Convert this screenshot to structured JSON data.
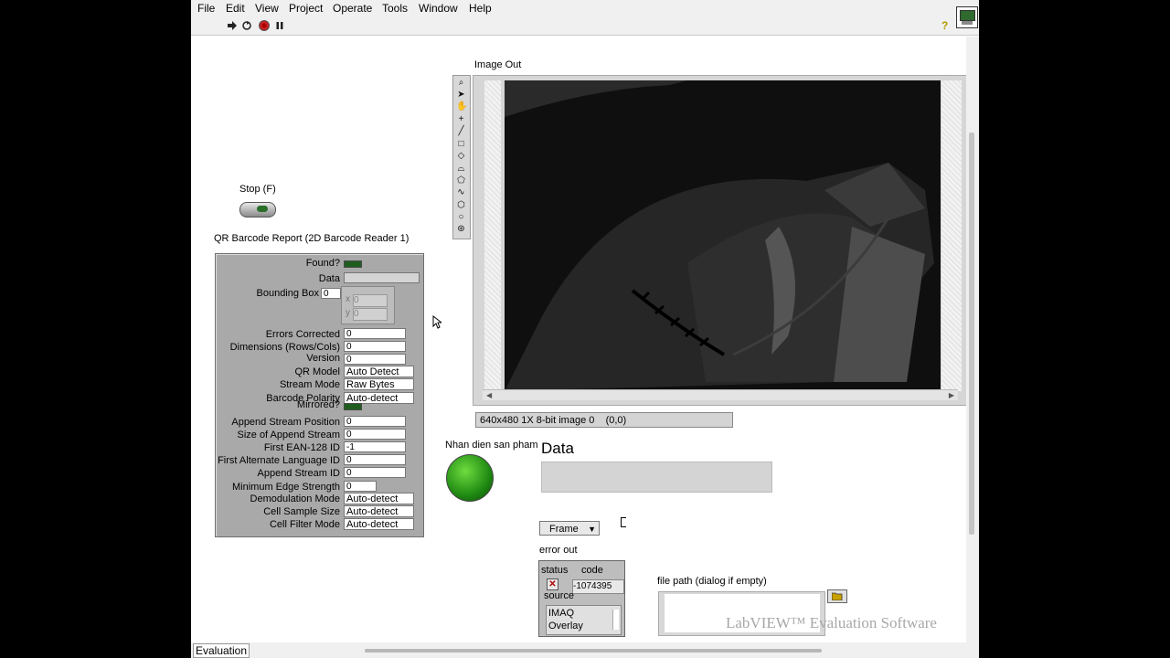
{
  "menu": [
    "File",
    "Edit",
    "View",
    "Project",
    "Operate",
    "Tools",
    "Window",
    "Help"
  ],
  "toolbar": {
    "icons": [
      "run-arrow-icon",
      "run-continuously-icon",
      "abort-icon",
      "pause-icon"
    ],
    "help_icon": "?"
  },
  "stop_button": {
    "label": "Stop (F)"
  },
  "qr_report": {
    "title": "QR Barcode Report (2D Barcode Reader 1)",
    "found_label": "Found?",
    "data_label": "Data",
    "data_value": "",
    "bounding_box_label": "Bounding Box",
    "bounding_box_index": "0",
    "bbox_x_label": "x",
    "bbox_x": "0",
    "bbox_y_label": "y",
    "bbox_y": "0",
    "errors_corrected_label": "Errors Corrected",
    "errors_corrected": "0",
    "dimensions_label": "Dimensions (Rows/Cols)",
    "dimensions": "0",
    "version_label": "Version",
    "version": "0",
    "qr_model_label": "QR Model",
    "qr_model": "Auto Detect",
    "stream_mode_label": "Stream Mode",
    "stream_mode": "Raw Bytes",
    "barcode_polarity_label": "Barcode Polarity",
    "barcode_polarity": "Auto-detect",
    "mirrored_label": "Mirrored?",
    "append_stream_position_label": "Append Stream Position",
    "append_stream_position": "0",
    "size_append_stream_label": "Size of Append Stream",
    "size_append_stream": "0",
    "first_ean_label": "First EAN-128 ID",
    "first_ean": "-1",
    "first_alt_lang_label": "First Alternate Language ID",
    "first_alt_lang": "0",
    "append_stream_id_label": "Append Stream ID",
    "append_stream_id": "0",
    "min_edge_label": "Minimum Edge Strength",
    "min_edge": "0",
    "demod_label": "Demodulation Mode",
    "demod": "Auto-detect",
    "cell_sample_label": "Cell Sample Size",
    "cell_sample": "Auto-detect",
    "cell_filter_label": "Cell Filter Mode",
    "cell_filter": "Auto-detect"
  },
  "image_out": {
    "label": "Image Out",
    "status": "640x480 1X 8-bit image 0    (0,0)"
  },
  "product_indicator": {
    "label": "Nhan dien san pham"
  },
  "data_display": {
    "label": "Data",
    "value": ""
  },
  "frame_selector": {
    "value": "Frame"
  },
  "error_out": {
    "label": "error out",
    "status_label": "status",
    "code_label": "code",
    "code": "-1074395",
    "source_label": "source",
    "source_line1": "IMAQ",
    "source_line2": "Overlay"
  },
  "file_path": {
    "label": "file path (dialog if empty)",
    "value": ""
  },
  "watermark": "LabVIEW™ Evaluation Software",
  "status_bar": {
    "label": "Evaluation"
  }
}
